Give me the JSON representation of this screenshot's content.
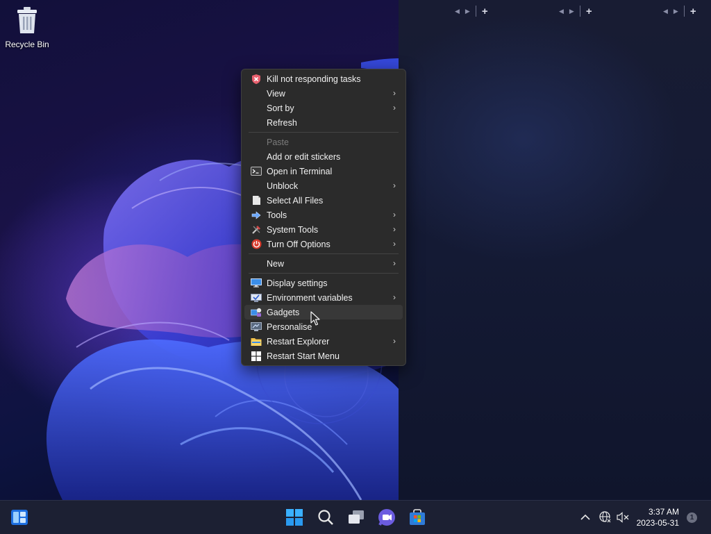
{
  "desktop": {
    "icons": [
      {
        "label": "Recycle Bin",
        "icon": "recycle-bin-icon"
      }
    ]
  },
  "panel_bars": {
    "plus": "+",
    "nav_back": "◀",
    "nav_forward": "▶"
  },
  "context_menu": {
    "items": [
      {
        "label": "Kill not responding tasks",
        "icon": "shield-x-icon",
        "submenu": false
      },
      {
        "label": "View",
        "submenu": true
      },
      {
        "label": "Sort by",
        "submenu": true
      },
      {
        "label": "Refresh",
        "submenu": false
      },
      {
        "label": "Paste",
        "submenu": false,
        "disabled": true
      },
      {
        "label": "Add or edit stickers",
        "submenu": false
      },
      {
        "label": "Open in Terminal",
        "icon": "terminal-icon",
        "submenu": false
      },
      {
        "label": "Unblock",
        "submenu": true
      },
      {
        "label": "Select All Files",
        "icon": "document-icon",
        "submenu": false
      },
      {
        "label": "Tools",
        "icon": "blue-arrow-icon",
        "submenu": true
      },
      {
        "label": "System Tools",
        "icon": "tools-icon",
        "submenu": true
      },
      {
        "label": "Turn Off Options",
        "icon": "power-icon",
        "submenu": true
      },
      {
        "label": "New",
        "submenu": true
      },
      {
        "label": "Display settings",
        "icon": "display-icon",
        "submenu": false
      },
      {
        "label": "Environment variables",
        "icon": "monitor-check-icon",
        "submenu": true
      },
      {
        "label": "Gadgets",
        "icon": "gadgets-icon",
        "submenu": false,
        "hovered": true
      },
      {
        "label": "Personalise",
        "icon": "personalise-icon",
        "submenu": false
      },
      {
        "label": "Restart Explorer",
        "icon": "folder-icon",
        "submenu": true
      },
      {
        "label": "Restart Start Menu",
        "icon": "windows-logo-icon",
        "submenu": false
      }
    ],
    "submenu_arrow": "›"
  },
  "taskbar": {
    "left": [
      {
        "name": "widgets-icon"
      }
    ],
    "center": [
      {
        "name": "start-button"
      },
      {
        "name": "search-button"
      },
      {
        "name": "task-view-button"
      },
      {
        "name": "teams-chat-button"
      },
      {
        "name": "microsoft-store-button"
      }
    ],
    "tray": {
      "chevron": "^",
      "time": "3:37 AM",
      "date": "2023-05-31",
      "notification_count": "1"
    }
  },
  "colors": {
    "menu_bg": "#2b2b2b",
    "taskbar_bg": "#1c2033",
    "accent": "#3b7bff"
  }
}
